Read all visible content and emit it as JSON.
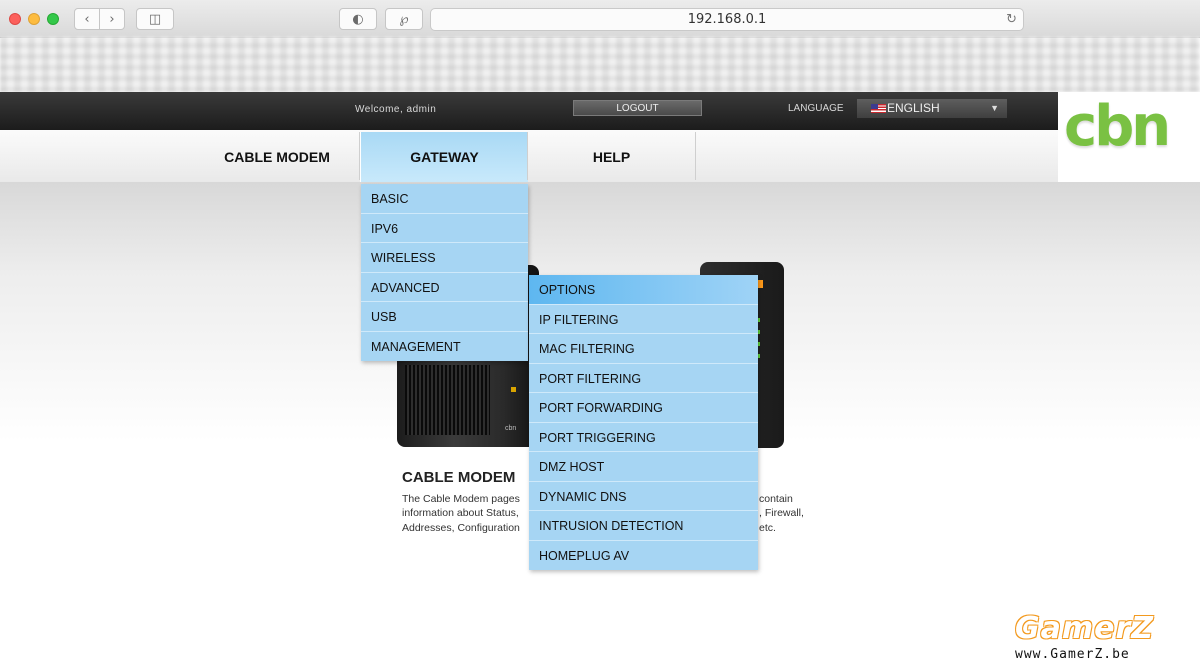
{
  "browser": {
    "url": "192.168.0.1",
    "icons": {
      "back": "chevron-left-icon",
      "forward": "chevron-right-icon",
      "sidebar": "sidebar-icon",
      "privacy": "toggle-icon",
      "extension": "extension-icon",
      "reload": "reload-icon"
    }
  },
  "header": {
    "welcome": "Welcome, admin",
    "logout_label": "LOGOUT",
    "language_label": "LANGUAGE",
    "language_value": "ENGLISH",
    "logo_text": "cbn"
  },
  "nav": {
    "items": [
      {
        "label": "CABLE MODEM"
      },
      {
        "label": "GATEWAY"
      },
      {
        "label": "HELP"
      }
    ]
  },
  "gateway_menu": [
    {
      "label": "BASIC"
    },
    {
      "label": "IPV6"
    },
    {
      "label": "WIRELESS"
    },
    {
      "label": "ADVANCED"
    },
    {
      "label": "USB"
    },
    {
      "label": "MANAGEMENT"
    }
  ],
  "advanced_menu": [
    {
      "label": "OPTIONS"
    },
    {
      "label": "IP FILTERING"
    },
    {
      "label": "MAC FILTERING"
    },
    {
      "label": "PORT FILTERING"
    },
    {
      "label": "PORT FORWARDING"
    },
    {
      "label": "PORT TRIGGERING"
    },
    {
      "label": "DMZ HOST"
    },
    {
      "label": "DYNAMIC DNS"
    },
    {
      "label": "INTRUSION DETECTION"
    },
    {
      "label": "HOMEPLUG AV"
    }
  ],
  "content": {
    "title": "CABLE MODEM",
    "desc_lines": [
      "The Cable Modem pages",
      "information about Status,",
      "Addresses, Configuration"
    ],
    "desc_right_lines": [
      "contain",
      ", Firewall,",
      "etc."
    ],
    "device_label": "cbn"
  },
  "watermark": {
    "main": "GamerZ",
    "sub": "www.GamerZ.be"
  },
  "colors": {
    "menu_bg": "#a6d5f3",
    "menu_active": "#5eb7f0",
    "logo_green": "#7ac143",
    "header_dark": "#1c1c1c"
  }
}
